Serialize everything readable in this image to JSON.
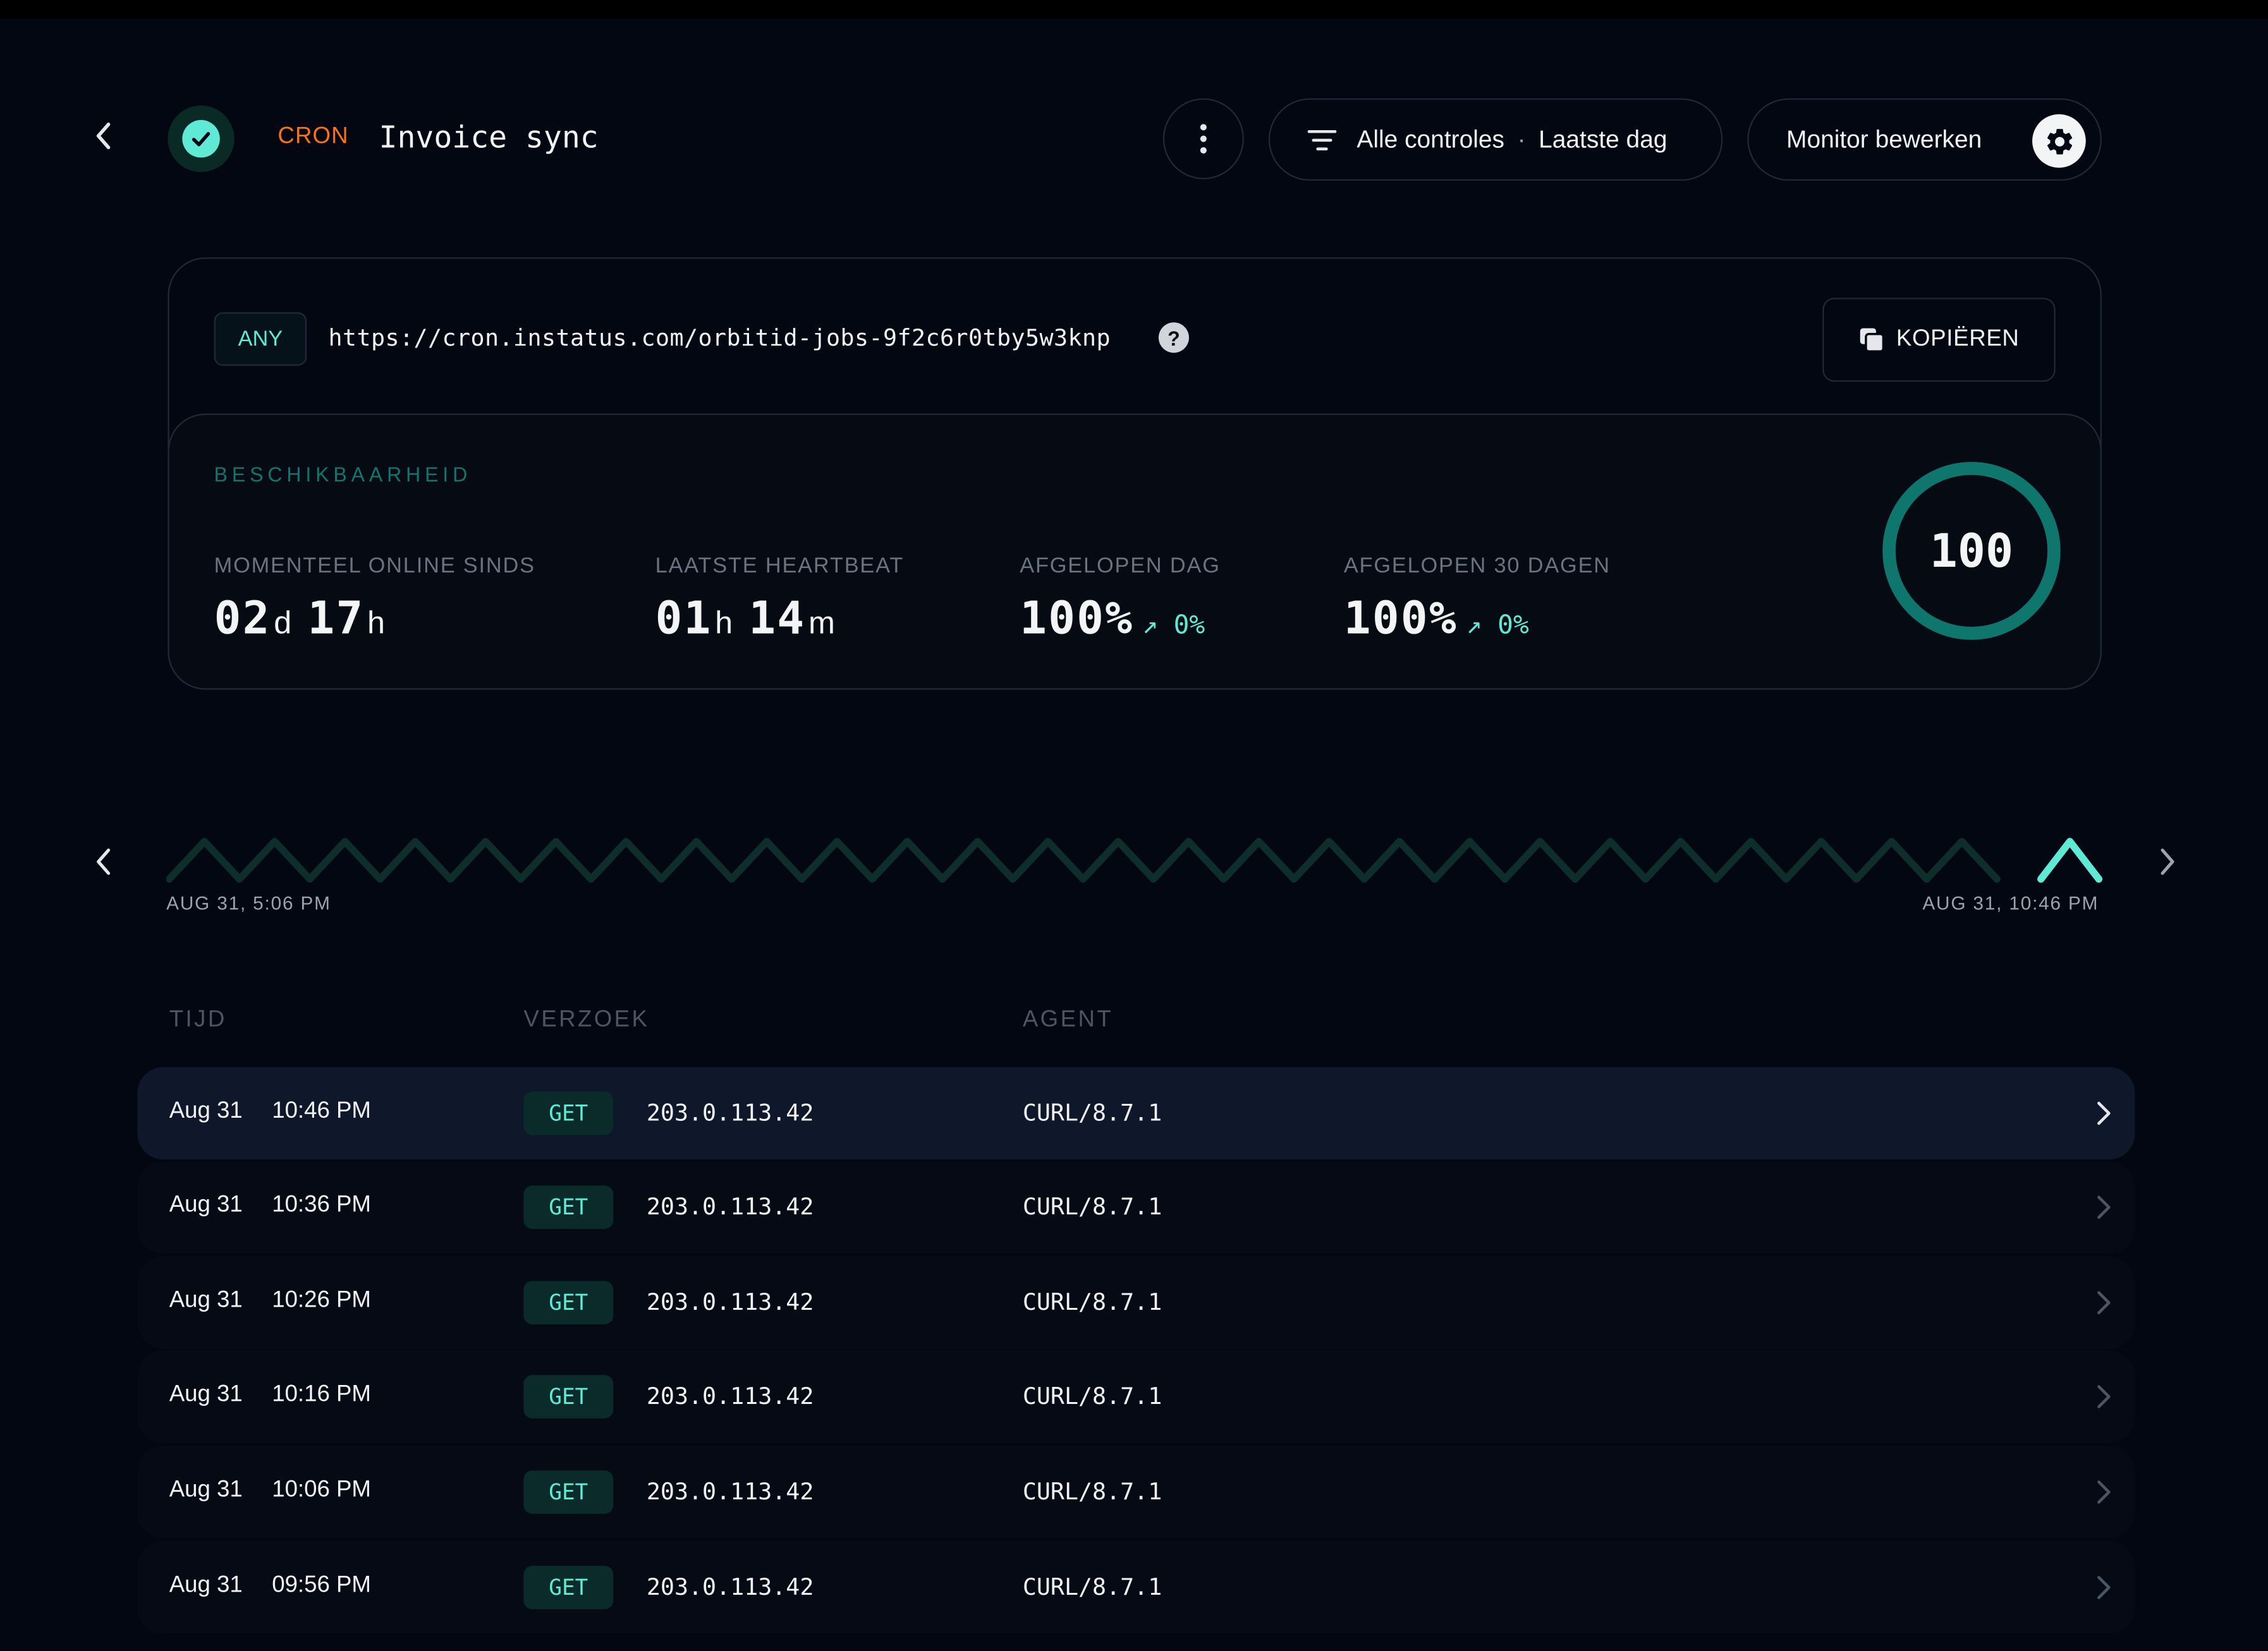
{
  "header": {
    "type_tag": "CRON",
    "title": "Invoice sync",
    "filter_label": "Alle controles",
    "filter_range": "Laatste dag",
    "filter_separator": "·",
    "edit_label": "Monitor bewerken"
  },
  "endpoint": {
    "method_badge": "ANY",
    "url": "https://cron.instatus.com/orbitid-jobs-9f2c6r0tby5w3knp",
    "help_glyph": "?",
    "copy_label": "KOPIËREN"
  },
  "availability": {
    "title": "BESCHIKBAARHEID",
    "stats": [
      {
        "label": "MOMENTEEL ONLINE SINDS",
        "v1": "02",
        "u1": "d",
        "v2": "17",
        "u2": "h"
      },
      {
        "label": "LAATSTE HEARTBEAT",
        "v1": "01",
        "u1": "h",
        "v2": "14",
        "u2": "m"
      },
      {
        "label": "AFGELOPEN DAG",
        "value": "100%",
        "trend": "↗ 0%"
      },
      {
        "label": "AFGELOPEN 30 DAGEN",
        "value": "100%",
        "trend": "↗ 0%"
      }
    ],
    "score": "100",
    "score_fraction": 1.0
  },
  "timeline": {
    "start_label": "AUG 31, 5:06 PM",
    "end_label": "AUG 31, 10:46 PM"
  },
  "table": {
    "headers": [
      "TIJD",
      "VERZOEK",
      "AGENT"
    ],
    "rows": [
      {
        "date": "Aug 31",
        "time": "10:46 PM",
        "method": "GET",
        "ip": "203.0.113.42",
        "agent": "CURL/8.7.1"
      },
      {
        "date": "Aug 31",
        "time": "10:36 PM",
        "method": "GET",
        "ip": "203.0.113.42",
        "agent": "CURL/8.7.1"
      },
      {
        "date": "Aug 31",
        "time": "10:26 PM",
        "method": "GET",
        "ip": "203.0.113.42",
        "agent": "CURL/8.7.1"
      },
      {
        "date": "Aug 31",
        "time": "10:16 PM",
        "method": "GET",
        "ip": "203.0.113.42",
        "agent": "CURL/8.7.1"
      },
      {
        "date": "Aug 31",
        "time": "10:06 PM",
        "method": "GET",
        "ip": "203.0.113.42",
        "agent": "CURL/8.7.1"
      },
      {
        "date": "Aug 31",
        "time": "09:56 PM",
        "method": "GET",
        "ip": "203.0.113.42",
        "agent": "CURL/8.7.1"
      }
    ]
  },
  "colors": {
    "accent": "#5eead4",
    "cron_tag": "#f97316",
    "ring": "#0f766e",
    "background": "#030712"
  },
  "icons": [
    "back-arrow-icon",
    "check-icon",
    "more-vertical-icon",
    "filter-icon",
    "gear-icon",
    "copy-icon",
    "help-icon",
    "chevron-left-icon",
    "chevron-right-icon"
  ]
}
